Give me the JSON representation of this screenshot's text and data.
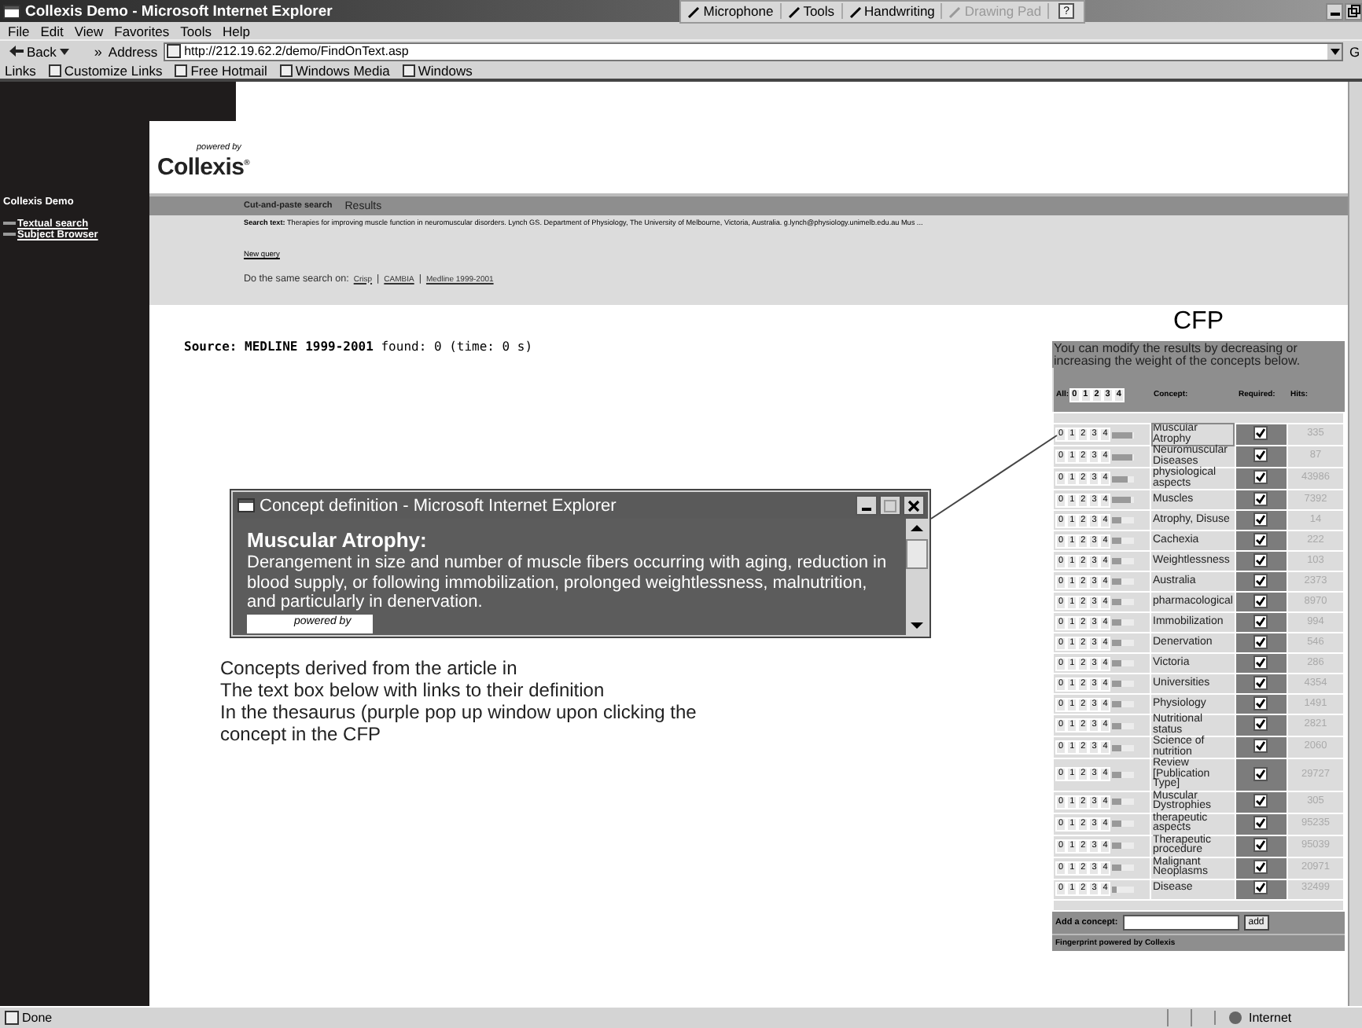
{
  "window": {
    "title": "Collexis Demo - Microsoft Internet Explorer"
  },
  "language_bar": {
    "items": [
      {
        "label": "Microphone",
        "disabled": false
      },
      {
        "label": "Tools",
        "disabled": false
      },
      {
        "label": "Handwriting",
        "disabled": false
      },
      {
        "label": "Drawing Pad",
        "disabled": true
      }
    ],
    "help": "?"
  },
  "menu": [
    "File",
    "Edit",
    "View",
    "Favorites",
    "Tools",
    "Help"
  ],
  "toolbar": {
    "back": "Back",
    "more": "»",
    "address_label": "Address",
    "url": "http://212.19.62.2/demo/FindOnText.asp",
    "go": "G"
  },
  "links_bar": {
    "label": "Links",
    "links": [
      "Customize Links",
      "Free Hotmail",
      "Windows Media",
      "Windows"
    ]
  },
  "sidebar": {
    "title": "Collexis Demo",
    "links": [
      "Textual search",
      "Subject Browser"
    ]
  },
  "logo": {
    "tagline": "powered by",
    "name": "Collexis",
    "mark": "®"
  },
  "nav_tabs": [
    {
      "label": "Cut-and-paste search",
      "selected": true
    },
    {
      "label": "Results",
      "selected": false
    }
  ],
  "search_text": {
    "label": "Search text:",
    "value": "Therapies for improving muscle function in neuromuscular disorders. Lynch GS. Department of Physiology, The University of Melbourne, Victoria, Australia. g.lynch@physiology.unimelb.edu.au Mus ..."
  },
  "new_query": "New query",
  "same_search": {
    "label": "Do the same search on:",
    "links": [
      "Crisp",
      "CAMBIA",
      "Medline 1999-2001"
    ],
    "separators": [
      "|",
      "|"
    ]
  },
  "source": {
    "label": "Source:",
    "name": "MEDLINE 1999-2001",
    "result": "found: 0 (time: 0 s)"
  },
  "cfp_label": "CFP",
  "cfp": {
    "intro": "You can modify the results by decreasing or increasing the weight of the concepts below.",
    "all_label": "All:",
    "all_weights": [
      "0",
      "1",
      "2",
      "3",
      "4"
    ],
    "columns": [
      "Concept:",
      "Required:",
      "Hits:"
    ],
    "rows": [
      {
        "weights": [
          "0",
          "1",
          "2",
          "3",
          "4"
        ],
        "level": 0.9,
        "concept": "Muscular Atrophy",
        "selected": true,
        "required": true,
        "hits": "335"
      },
      {
        "weights": [
          "0",
          "1",
          "2",
          "3",
          "4"
        ],
        "level": 0.9,
        "concept": "Neuromuscular Diseases",
        "selected": false,
        "required": true,
        "hits": "87"
      },
      {
        "weights": [
          "0",
          "1",
          "2",
          "3",
          "4"
        ],
        "level": 0.7,
        "concept": "physiological aspects",
        "selected": false,
        "required": true,
        "hits": "43986"
      },
      {
        "weights": [
          "0",
          "1",
          "2",
          "3",
          "4"
        ],
        "level": 0.8,
        "concept": "Muscles",
        "selected": false,
        "required": true,
        "hits": "7392"
      },
      {
        "weights": [
          "0",
          "1",
          "2",
          "3",
          "4"
        ],
        "level": 0.4,
        "concept": "Atrophy, Disuse",
        "selected": false,
        "required": true,
        "hits": "14"
      },
      {
        "weights": [
          "0",
          "1",
          "2",
          "3",
          "4"
        ],
        "level": 0.4,
        "concept": "Cachexia",
        "selected": false,
        "required": true,
        "hits": "222"
      },
      {
        "weights": [
          "0",
          "1",
          "2",
          "3",
          "4"
        ],
        "level": 0.4,
        "concept": "Weightlessness",
        "selected": false,
        "required": true,
        "hits": "103"
      },
      {
        "weights": [
          "0",
          "1",
          "2",
          "3",
          "4"
        ],
        "level": 0.4,
        "concept": "Australia",
        "selected": false,
        "required": true,
        "hits": "2373"
      },
      {
        "weights": [
          "0",
          "1",
          "2",
          "3",
          "4"
        ],
        "level": 0.4,
        "concept": "pharmacological",
        "selected": false,
        "required": true,
        "hits": "8970"
      },
      {
        "weights": [
          "0",
          "1",
          "2",
          "3",
          "4"
        ],
        "level": 0.4,
        "concept": "Immobilization",
        "selected": false,
        "required": true,
        "hits": "994"
      },
      {
        "weights": [
          "0",
          "1",
          "2",
          "3",
          "4"
        ],
        "level": 0.4,
        "concept": "Denervation",
        "selected": false,
        "required": true,
        "hits": "546"
      },
      {
        "weights": [
          "0",
          "1",
          "2",
          "3",
          "4"
        ],
        "level": 0.4,
        "concept": "Victoria",
        "selected": false,
        "required": true,
        "hits": "286"
      },
      {
        "weights": [
          "0",
          "1",
          "2",
          "3",
          "4"
        ],
        "level": 0.4,
        "concept": "Universities",
        "selected": false,
        "required": true,
        "hits": "4354"
      },
      {
        "weights": [
          "0",
          "1",
          "2",
          "3",
          "4"
        ],
        "level": 0.4,
        "concept": "Physiology",
        "selected": false,
        "required": true,
        "hits": "1491"
      },
      {
        "weights": [
          "0",
          "1",
          "2",
          "3",
          "4"
        ],
        "level": 0.4,
        "concept": "Nutritional status",
        "selected": false,
        "required": true,
        "hits": "2821"
      },
      {
        "weights": [
          "0",
          "1",
          "2",
          "3",
          "4"
        ],
        "level": 0.4,
        "concept": "Science of nutrition",
        "selected": false,
        "required": true,
        "hits": "2060"
      },
      {
        "weights": [
          "0",
          "1",
          "2",
          "3",
          "4"
        ],
        "level": 0.4,
        "concept": "Review [Publication Type]",
        "selected": false,
        "required": true,
        "hits": "29727"
      },
      {
        "weights": [
          "0",
          "1",
          "2",
          "3",
          "4"
        ],
        "level": 0.4,
        "concept": "Muscular Dystrophies",
        "selected": false,
        "required": true,
        "hits": "305"
      },
      {
        "weights": [
          "0",
          "1",
          "2",
          "3",
          "4"
        ],
        "level": 0.4,
        "concept": "therapeutic aspects",
        "selected": false,
        "required": true,
        "hits": "95235"
      },
      {
        "weights": [
          "0",
          "1",
          "2",
          "3",
          "4"
        ],
        "level": 0.4,
        "concept": "Therapeutic procedure",
        "selected": false,
        "required": true,
        "hits": "95039"
      },
      {
        "weights": [
          "0",
          "1",
          "2",
          "3",
          "4"
        ],
        "level": 0.4,
        "concept": "Malignant Neoplasms",
        "selected": false,
        "required": true,
        "hits": "20971"
      },
      {
        "weights": [
          "0",
          "1",
          "2",
          "3",
          "4"
        ],
        "level": 0.2,
        "concept": "Disease",
        "selected": false,
        "required": true,
        "hits": "32499"
      }
    ],
    "add_label": "Add a concept:",
    "add_button": "add",
    "footer": "Fingerprint powered by Collexis"
  },
  "popup": {
    "title": "Concept definition - Microsoft Internet Explorer",
    "heading": "Muscular Atrophy:",
    "definition": "Derangement in size and number of muscle fibers occurring with aging, reduction in blood supply, or following immobilization, prolonged weightlessness, malnutrition, and particularly in denervation.",
    "logo_tagline": "powered by"
  },
  "annotation": [
    "Concepts derived from the article in",
    "The text box below with links to their definition",
    "In the thesaurus (purple pop up window upon clicking the",
    "concept in the CFP"
  ],
  "status_bar": {
    "text": "Done",
    "zone": "Internet"
  }
}
